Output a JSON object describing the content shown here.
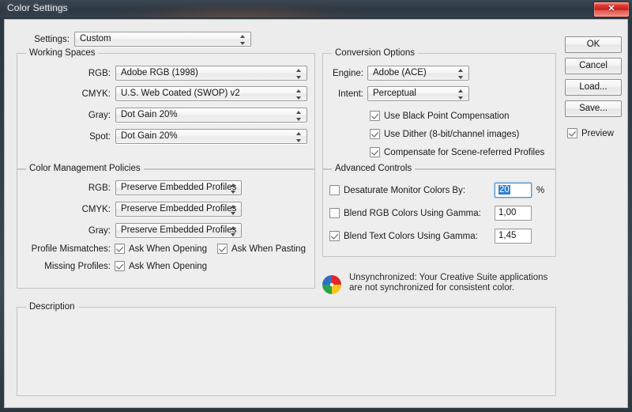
{
  "window": {
    "title": "Color Settings",
    "close_label": "✕",
    "accent_close": "#c21c17"
  },
  "settings_row": {
    "label": "Settings:",
    "value": "Custom"
  },
  "working_spaces": {
    "title": "Working Spaces",
    "rows": [
      {
        "label": "RGB:",
        "value": "Adobe RGB (1998)"
      },
      {
        "label": "CMYK:",
        "value": "U.S. Web Coated (SWOP) v2"
      },
      {
        "label": "Gray:",
        "value": "Dot Gain 20%"
      },
      {
        "label": "Spot:",
        "value": "Dot Gain 20%"
      }
    ]
  },
  "color_management_policies": {
    "title": "Color Management Policies",
    "rows": [
      {
        "label": "RGB:",
        "value": "Preserve Embedded Profiles"
      },
      {
        "label": "CMYK:",
        "value": "Preserve Embedded Profiles"
      },
      {
        "label": "Gray:",
        "value": "Preserve Embedded Profiles"
      }
    ],
    "profile_mismatches_label": "Profile Mismatches:",
    "profile_mismatches": [
      {
        "label": "Ask When Opening",
        "checked": true
      },
      {
        "label": "Ask When Pasting",
        "checked": true
      }
    ],
    "missing_profiles_label": "Missing Profiles:",
    "missing_profiles": [
      {
        "label": "Ask When Opening",
        "checked": true
      }
    ]
  },
  "conversion_options": {
    "title": "Conversion Options",
    "rows": [
      {
        "label": "Engine:",
        "value": "Adobe (ACE)"
      },
      {
        "label": "Intent:",
        "value": "Perceptual"
      }
    ],
    "checkboxes": [
      {
        "label": "Use Black Point Compensation",
        "checked": true
      },
      {
        "label": "Use Dither (8-bit/channel images)",
        "checked": true
      },
      {
        "label": "Compensate for Scene-referred Profiles",
        "checked": true
      }
    ]
  },
  "advanced_controls": {
    "title": "Advanced Controls",
    "rows": [
      {
        "label": "Desaturate Monitor Colors By:",
        "checked": false,
        "value": "20",
        "suffix": "%",
        "focused": true
      },
      {
        "label": "Blend RGB Colors Using Gamma:",
        "checked": false,
        "value": "1,00",
        "suffix": "",
        "focused": false
      },
      {
        "label": "Blend Text Colors Using Gamma:",
        "checked": true,
        "value": "1,45",
        "suffix": "",
        "focused": false
      }
    ]
  },
  "sync_status": {
    "icon": "adobe-sync-icon",
    "line1": "Unsynchronized: Your Creative Suite applications",
    "line2": "are not synchronized for consistent color."
  },
  "description": {
    "title": "Description",
    "text": ""
  },
  "buttons": {
    "ok": "OK",
    "cancel": "Cancel",
    "load": "Load...",
    "save": "Save...",
    "preview_label": "Preview",
    "preview_checked": true
  }
}
